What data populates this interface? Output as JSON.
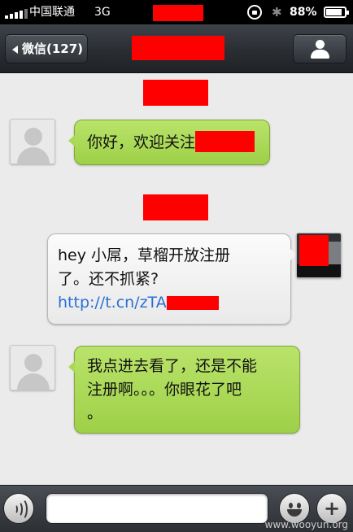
{
  "status_bar": {
    "carrier": "中国联通",
    "network": "3G",
    "bluetooth_symbol": "✱",
    "battery_text": "88%",
    "battery_level": 0.88
  },
  "nav": {
    "back_label": "微信(127)"
  },
  "messages": [
    {
      "side": "left",
      "text_before": "你好，欢迎关注",
      "text_lines": []
    },
    {
      "side": "right",
      "text_lines": [
        "hey 小屌，草榴开放注册",
        "了。还不抓紧?"
      ],
      "link": "http://t.cn/zTA"
    },
    {
      "side": "left",
      "text_lines": [
        "我点进去看了，还是不能",
        "注册啊。。。你眼花了吧",
        "。"
      ]
    }
  ],
  "input": {
    "placeholder": "",
    "emoji_symbol": "☺",
    "plus_symbol": "+"
  },
  "watermark": "www.wooyun.org",
  "colors": {
    "redaction": "#ff0000",
    "bubble_green": "#a9d855",
    "link": "#2a6fd8"
  }
}
